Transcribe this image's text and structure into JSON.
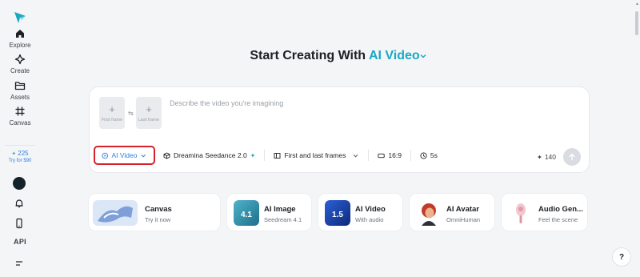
{
  "sidebar": {
    "items": [
      {
        "label": "Explore",
        "icon": "home-icon"
      },
      {
        "label": "Create",
        "icon": "sparkle-icon"
      },
      {
        "label": "Assets",
        "icon": "folder-icon"
      },
      {
        "label": "Canvas",
        "icon": "canvas-grid-icon"
      }
    ],
    "credits": "225",
    "try_text": "Try for $90",
    "api_label": "API"
  },
  "heading": {
    "prefix": "Start Creating With",
    "mode": "AI Video"
  },
  "prompt": {
    "first_frame": "First frame",
    "last_frame": "Last frame",
    "placeholder": "Describe the video you're imagining"
  },
  "toolbar": {
    "mode": "AI Video",
    "model": "Dreamina Seedance 2.0",
    "frames": "First and last frames",
    "ratio": "16:9",
    "duration": "5s",
    "credit_cost": "140"
  },
  "cards": [
    {
      "title": "Canvas",
      "subtitle": "Try it now"
    },
    {
      "title": "AI Image",
      "subtitle": "Seedream 4.1",
      "badge": "4.1"
    },
    {
      "title": "AI Video",
      "subtitle": "With audio",
      "badge": "1.5"
    },
    {
      "title": "AI Avatar",
      "subtitle": "OmniHuman"
    },
    {
      "title": "Audio Gen...",
      "subtitle": "Feel the scene"
    }
  ],
  "help": "?",
  "colors": {
    "accent": "#19a8c4",
    "link_blue": "#2f7fe0",
    "highlight_border": "#d6212b",
    "background": "#f4f5f7"
  }
}
